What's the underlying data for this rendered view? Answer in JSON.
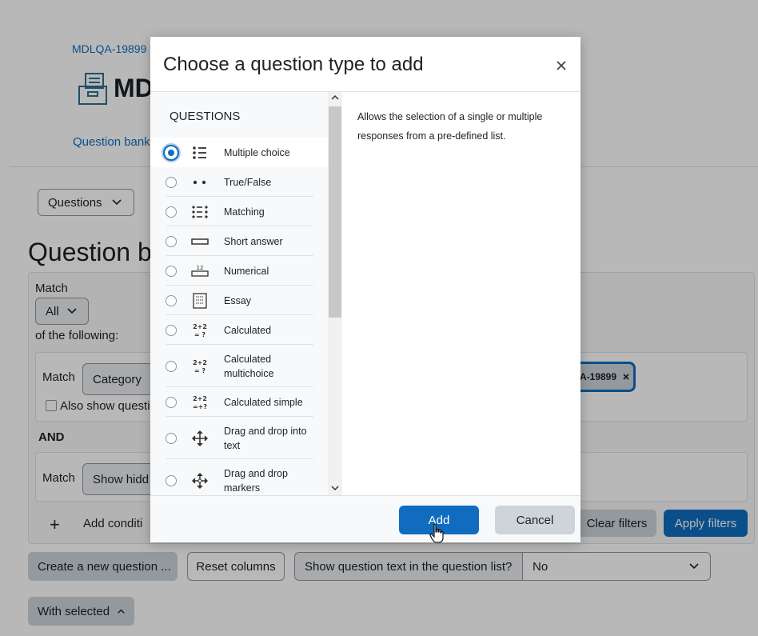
{
  "page": {
    "breadcrumb": "MDLQA-19899",
    "course_title": "MD",
    "section_link": "Question bank",
    "questions_dropdown": "Questions",
    "heading": "Question ba",
    "filter": {
      "match_label": "Match",
      "match_value": "All",
      "of_following": "of the following:",
      "condition1_match": "Match",
      "condition1_field": "Category",
      "also_show": "Also show questi",
      "tag": "A-19899",
      "and_label": "AND",
      "condition2_match": "Match",
      "condition2_field": "Show hidd",
      "add_condition": "Add conditi",
      "clear_filters": "Clear filters",
      "apply_filters": "Apply filters"
    },
    "create_question": "Create a new question ...",
    "reset_columns": "Reset columns",
    "show_text_label": "Show question text in the question list?",
    "show_text_value": "No",
    "with_selected": "With selected"
  },
  "modal": {
    "title": "Choose a question type to add",
    "section_heading": "QUESTIONS",
    "options": [
      {
        "label": "Multiple choice",
        "icon": "multiple-choice-icon",
        "selected": true
      },
      {
        "label": "True/False",
        "icon": "true-false-icon",
        "selected": false
      },
      {
        "label": "Matching",
        "icon": "matching-icon",
        "selected": false
      },
      {
        "label": "Short answer",
        "icon": "short-answer-icon",
        "selected": false
      },
      {
        "label": "Numerical",
        "icon": "numerical-icon",
        "selected": false
      },
      {
        "label": "Essay",
        "icon": "essay-icon",
        "selected": false
      },
      {
        "label": "Calculated",
        "icon": "calculated-icon",
        "selected": false
      },
      {
        "label": "Calculated multichoice",
        "icon": "calculated-multichoice-icon",
        "selected": false
      },
      {
        "label": "Calculated simple",
        "icon": "calculated-simple-icon",
        "selected": false
      },
      {
        "label": "Drag and drop into text",
        "icon": "drag-drop-text-icon",
        "selected": false
      },
      {
        "label": "Drag and drop markers",
        "icon": "drag-drop-markers-icon",
        "selected": false
      }
    ],
    "description": "Allows the selection of a single or multiple responses from a pre-defined list.",
    "add_label": "Add",
    "cancel_label": "Cancel"
  },
  "colors": {
    "primary": "#0f6cbf",
    "secondary": "#ced4da",
    "link": "#0f6cbf"
  }
}
